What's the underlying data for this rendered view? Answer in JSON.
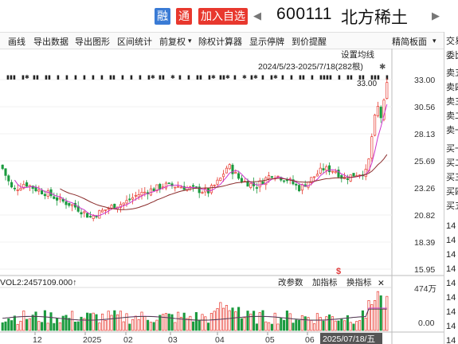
{
  "header": {
    "rong_label": "融",
    "tong_label": "通",
    "add_watchlist_label": "加入自选",
    "stock_code": "600111",
    "stock_name": "北方稀土",
    "prev_arrow": "◀",
    "next_arrow": "▶"
  },
  "toolbar": {
    "items": [
      "画线",
      "导出数据",
      "导出图形",
      "区间统计",
      "前复权",
      "除权计算器",
      "显示停牌",
      "到价提醒"
    ],
    "dropdown_marker": "▾",
    "simple_panel_label": "精简板面"
  },
  "right_panel": {
    "labels": [
      "交易",
      "委比",
      "卖五",
      "卖四",
      "卖三",
      "卖二",
      "卖一",
      "买一",
      "买二",
      "买三",
      "买四",
      "买五",
      "14",
      "14",
      "14",
      "14",
      "14",
      "14",
      "14",
      "14",
      "14"
    ]
  },
  "chart": {
    "ma_settings_label": "设置均线",
    "date_range_label": "2024/5/23-2025/7/18(282根)",
    "max_price_label": "33.00",
    "special_marker": "$",
    "volume_label": "VOL2:2457109.000↑",
    "change_params_label": "改参数",
    "add_indicator_label": "加指标",
    "switch_indicator_label": "换指标",
    "close_label": "✕",
    "volume_max_label": "474万",
    "volume_zero_label": "0.00",
    "current_date_label": "2025/07/18/五",
    "colors": {
      "up": "#e8382e",
      "down": "#1b9a3f",
      "ma5": "#cc33cc",
      "ma10": "#8b2c2c",
      "flag": "#e03a3a"
    }
  },
  "chart_data": {
    "type": "candlestick",
    "price_axis_ticks": [
      33.0,
      30.56,
      28.13,
      25.69,
      23.26,
      20.82,
      18.39,
      15.95
    ],
    "ylim": [
      15.95,
      33.0
    ],
    "x_tick_labels": [
      "12",
      "2025",
      "02",
      "03",
      "04",
      "05",
      "06",
      "07"
    ],
    "volume_axis_ticks": [
      "474万",
      "0.00"
    ],
    "series": [
      {
        "name": "price",
        "max": 33.0,
        "min": 19.8
      },
      {
        "name": "volume",
        "max": 4740000
      }
    ]
  }
}
